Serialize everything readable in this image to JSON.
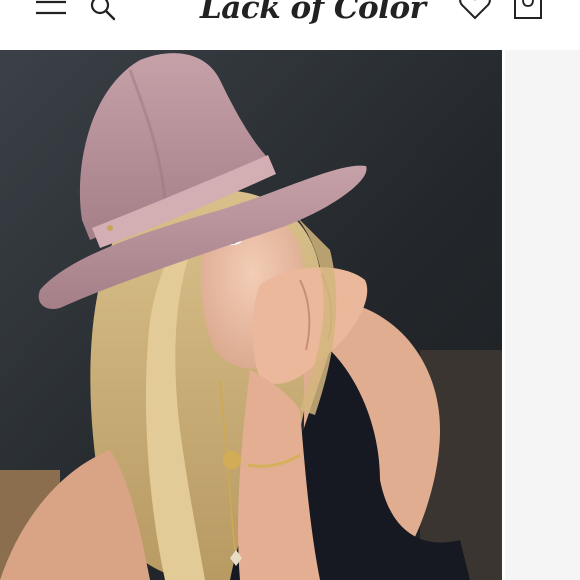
{
  "header": {
    "logo_text": "Lack of Color",
    "menu_icon": "hamburger-menu-icon",
    "search_icon": "search-icon",
    "wishlist_icon": "heart-icon",
    "cart_icon": "shopping-bag-icon"
  },
  "product": {
    "hat_color": "#b58e96",
    "background_color": "#2a2e33"
  }
}
